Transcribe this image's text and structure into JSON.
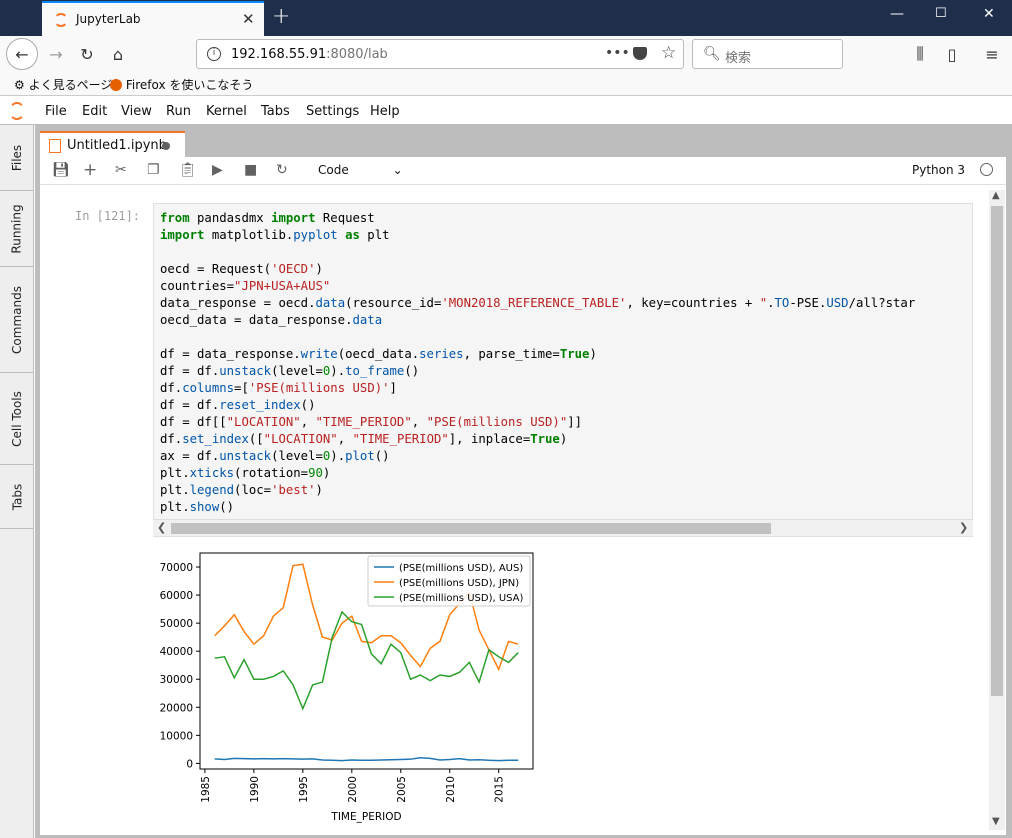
{
  "browser": {
    "tab_title": "JupyterLab",
    "url_host": "192.168.55.91",
    "url_rest": ":8080/lab",
    "search_placeholder": "検索",
    "bookmarks": [
      "よく見るページ",
      "Firefox を使いこなそう"
    ]
  },
  "jupyter": {
    "menu": [
      "File",
      "Edit",
      "View",
      "Run",
      "Kernel",
      "Tabs",
      "Settings",
      "Help"
    ],
    "sidebar": [
      "Files",
      "Running",
      "Commands",
      "Cell Tools",
      "Tabs"
    ],
    "notebook_tab": "Untitled1.ipynb",
    "cell_type": "Code",
    "kernel": "Python 3",
    "prompt": "In [121]:"
  },
  "code_lines": [
    "from pandasdmx import Request",
    "import matplotlib.pyplot as plt",
    "",
    "oecd = Request('OECD')",
    "countries=\"JPN+USA+AUS\"",
    "data_response = oecd.data(resource_id='MON2018_REFERENCE_TABLE', key=countries + \".TO-PSE.USD/all?star",
    "oecd_data = data_response.data",
    "",
    "df = data_response.write(oecd_data.series, parse_time=True)",
    "df = df.unstack(level=0).to_frame()",
    "df.columns=['PSE(millions USD)']",
    "df = df.reset_index()",
    "df = df[[\"LOCATION\", \"TIME_PERIOD\", \"PSE(millions USD)\"]]",
    "df.set_index([\"LOCATION\", \"TIME_PERIOD\"], inplace=True)",
    "ax = df.unstack(level=0).plot()",
    "plt.xticks(rotation=90)",
    "plt.legend(loc='best')",
    "plt.show()"
  ],
  "chart_data": {
    "type": "line",
    "xlabel": "TIME_PERIOD",
    "ylabel": "",
    "x": [
      1986,
      1987,
      1988,
      1989,
      1990,
      1991,
      1992,
      1993,
      1994,
      1995,
      1996,
      1997,
      1998,
      1999,
      2000,
      2001,
      2002,
      2003,
      2004,
      2005,
      2006,
      2007,
      2008,
      2009,
      2010,
      2011,
      2012,
      2013,
      2014,
      2015,
      2016,
      2017
    ],
    "xlim": [
      1984.5,
      2018.5
    ],
    "ylim": [
      -2000,
      75000
    ],
    "xticks": [
      1985,
      1990,
      1995,
      2000,
      2005,
      2010,
      2015
    ],
    "yticks": [
      0,
      10000,
      20000,
      30000,
      40000,
      50000,
      60000,
      70000
    ],
    "legend_position": "top-right",
    "series": [
      {
        "name": "(PSE(millions USD), AUS)",
        "color": "#1f77b4",
        "values": [
          1600,
          1400,
          1800,
          1700,
          1600,
          1700,
          1600,
          1700,
          1600,
          1500,
          1600,
          1200,
          1100,
          1000,
          1200,
          1100,
          1100,
          1200,
          1300,
          1400,
          1500,
          2000,
          1800,
          1200,
          1400,
          1700,
          1200,
          1300,
          1100,
          1000,
          1100,
          1100
        ]
      },
      {
        "name": "(PSE(millions USD), JPN)",
        "color": "#ff7f0e",
        "values": [
          45500,
          49000,
          53000,
          47000,
          42500,
          45500,
          52500,
          55500,
          70500,
          71000,
          56500,
          45000,
          44000,
          50000,
          52500,
          43500,
          43000,
          45500,
          45500,
          43000,
          38500,
          34500,
          41000,
          43500,
          53000,
          57000,
          61000,
          47500,
          40500,
          33500,
          43500,
          42500
        ]
      },
      {
        "name": "(PSE(millions USD), USA)",
        "color": "#2ca02c",
        "values": [
          37500,
          38000,
          30500,
          37000,
          30000,
          30000,
          31000,
          33000,
          28000,
          19500,
          28000,
          29000,
          45000,
          54000,
          50500,
          49500,
          39000,
          35500,
          42500,
          39500,
          30000,
          31500,
          29500,
          31500,
          31000,
          32500,
          36000,
          29000,
          40500,
          38000,
          36000,
          39500
        ]
      }
    ]
  },
  "colors": {
    "titlebar": "#1f2e4a",
    "jupyter_accent": "#f37726",
    "keyword": "#008000",
    "string": "#ba2121"
  }
}
